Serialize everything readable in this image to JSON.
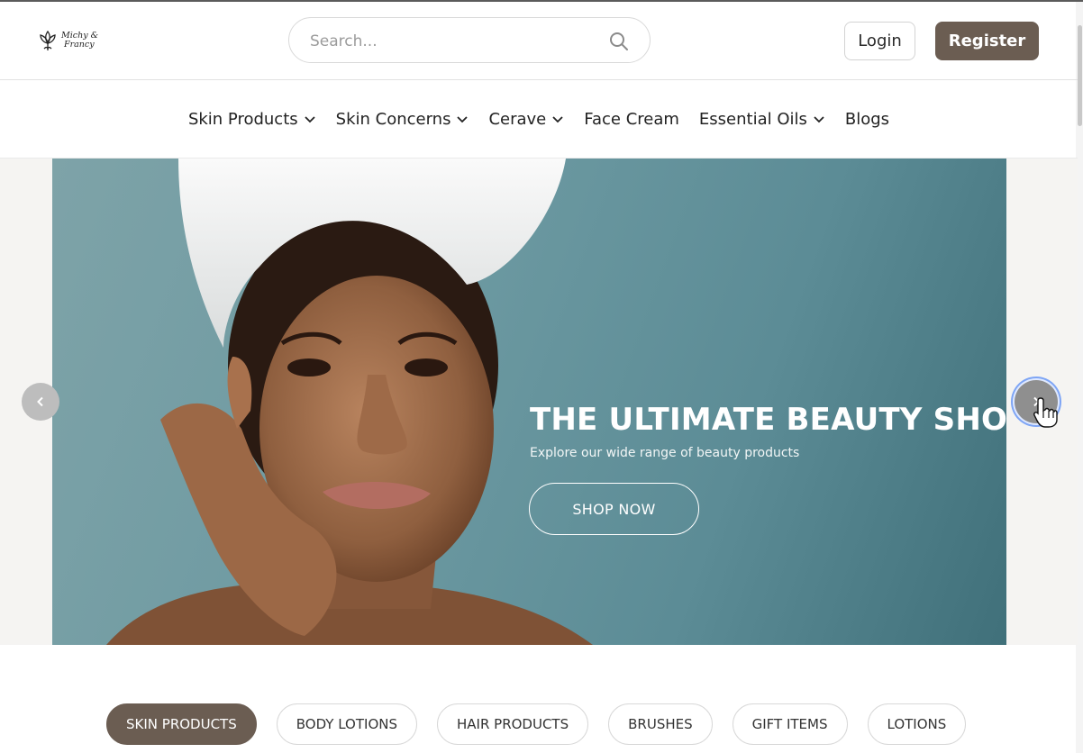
{
  "brand": {
    "name_line1": "Michy &",
    "name_line2": "Francy",
    "logo_icon": "lotus-icon"
  },
  "search": {
    "placeholder": "Search...",
    "value": ""
  },
  "header": {
    "login_label": "Login",
    "register_label": "Register"
  },
  "nav": {
    "items": [
      {
        "label": "Skin Products",
        "has_dropdown": true
      },
      {
        "label": "Skin Concerns",
        "has_dropdown": true
      },
      {
        "label": "Cerave",
        "has_dropdown": true
      },
      {
        "label": "Face Cream",
        "has_dropdown": false
      },
      {
        "label": "Essential Oils",
        "has_dropdown": true
      },
      {
        "label": "Blogs",
        "has_dropdown": false
      }
    ]
  },
  "hero": {
    "title": "THE ULTIMATE BEAUTY SHOP",
    "subtitle": "Explore our wide range of beauty products",
    "cta_label": "SHOP NOW",
    "prev_icon": "chevron-left-icon",
    "next_icon": "chevron-right-icon"
  },
  "categories": {
    "items": [
      {
        "label": "SKIN PRODUCTS",
        "active": true
      },
      {
        "label": "BODY LOTIONS",
        "active": false
      },
      {
        "label": "HAIR PRODUCTS",
        "active": false
      },
      {
        "label": "BRUSHES",
        "active": false
      },
      {
        "label": "GIFT ITEMS",
        "active": false
      },
      {
        "label": "LOTIONS",
        "active": false
      }
    ]
  },
  "colors": {
    "accent": "#6b5d52",
    "hero_bg": "#6c99a1",
    "page_band": "#f5f4f2"
  }
}
